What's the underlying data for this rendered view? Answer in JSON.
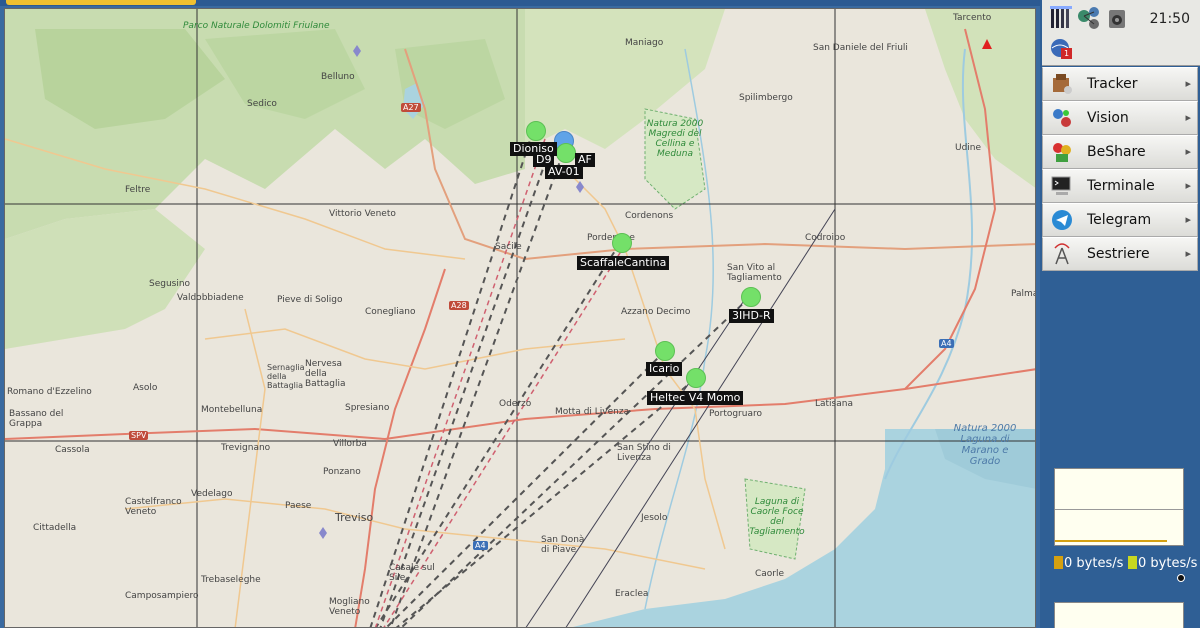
{
  "clock": "21:50",
  "tray": {
    "icons": [
      "signal-bars-icon",
      "network-nodes-icon",
      "speaker-icon",
      "notification-globe-icon"
    ],
    "notification_badge": "1"
  },
  "menu": [
    {
      "label": "Tracker",
      "icon": "tracker-icon"
    },
    {
      "label": "Vision",
      "icon": "vision-icon"
    },
    {
      "label": "BeShare",
      "icon": "beshare-icon"
    },
    {
      "label": "Terminale",
      "icon": "terminal-icon"
    },
    {
      "label": "Telegram",
      "icon": "telegram-icon"
    },
    {
      "label": "Sestriere",
      "icon": "antenna-icon"
    }
  ],
  "network": {
    "rx_value": "0",
    "rx_unit": "bytes/s",
    "tx_value": "0",
    "tx_unit": "bytes/s",
    "rx_color": "#d4a010",
    "tx_color": "#c8d820"
  },
  "map": {
    "nodes": [
      {
        "label": "Dioniso",
        "color": "green"
      },
      {
        "label": "D9",
        "color": "blue"
      },
      {
        "label": "AF",
        "color": "green"
      },
      {
        "label": "AV-01",
        "color": "green"
      },
      {
        "label": "ScaffaleCantina",
        "color": "green"
      },
      {
        "label": "3IHD-R",
        "color": "green"
      },
      {
        "label": "Icario",
        "color": "green"
      },
      {
        "label": "Heltec V4 Momo",
        "color": "green"
      }
    ],
    "places": [
      "Parco Naturale Dolomiti Friulane",
      "Belluno",
      "Sedico",
      "Feltre",
      "Vittorio Veneto",
      "Sacile",
      "Pordenone",
      "Cordenons",
      "Maniago",
      "Spilimbergo",
      "San Daniele del Friuli",
      "Udine",
      "Codroipo",
      "Conegliano",
      "Pieve di Soligo",
      "Valdobbiadene",
      "Segusino",
      "Nervesa della Battaglia",
      "Azzano Decimo",
      "Oderzo",
      "Motta di Livenza",
      "Portogruaro",
      "Latisana",
      "San Stino di Livenza",
      "Treviso",
      "Montebelluna",
      "Castelfranco Veneto",
      "Bassano del Grappa",
      "Cittadella",
      "San Donà di Piave",
      "Jesolo",
      "Caorle",
      "Eraclea",
      "Mogliano Veneto",
      "Spresiano",
      "Villorba",
      "Ponzano",
      "Trevignano",
      "Vedelago",
      "Paese",
      "Cassola",
      "Asolo",
      "Romano d'Ezzelino",
      "Camposampiero",
      "Trebaseleghe",
      "Casale sul Sile",
      "San Vito al Tagliamento",
      "Palma",
      "Tarcento",
      "Sernaglia della Battaglia"
    ],
    "parks": [
      "Natura 2000 Magredi del Cellina e Meduna",
      "Laguna di Caorle Foce del Tagliamento",
      "Natura 2000 Laguna di Marano e Grado"
    ],
    "roads": [
      "A27",
      "A28",
      "A4",
      "SPV",
      "A4"
    ],
    "sea_label": "Natura 2000 Laguna di Marano e Grado"
  }
}
